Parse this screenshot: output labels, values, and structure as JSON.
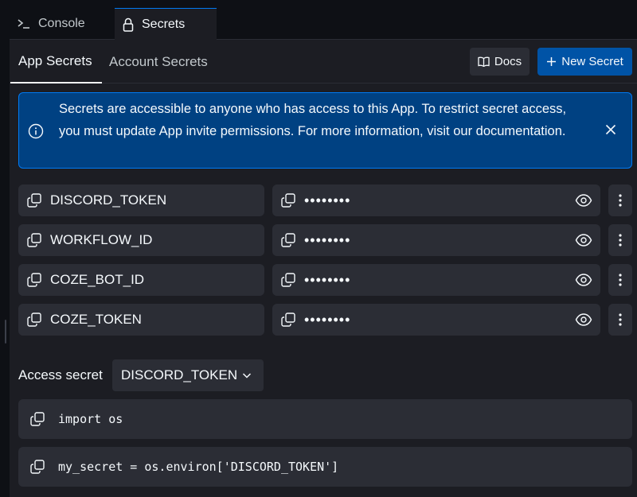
{
  "tabs": {
    "console_label": "Console",
    "secrets_label": "Secrets"
  },
  "subnav": {
    "app_secrets": "App Secrets",
    "account_secrets": "Account Secrets"
  },
  "actions": {
    "docs_label": "Docs",
    "new_secret_label": "New Secret"
  },
  "banner": {
    "message": "Secrets are accessible to anyone who has access to this App. To restrict secret access, you must update App invite permissions. For more information, visit our documentation."
  },
  "secrets": [
    {
      "key": "DISCORD_TOKEN",
      "masked_value": "••••••••"
    },
    {
      "key": "WORKFLOW_ID",
      "masked_value": "••••••••"
    },
    {
      "key": "COZE_BOT_ID",
      "masked_value": "••••••••"
    },
    {
      "key": "COZE_TOKEN",
      "masked_value": "••••••••"
    }
  ],
  "access": {
    "label": "Access secret",
    "selected": "DISCORD_TOKEN"
  },
  "code": {
    "line1": "import os",
    "line2": "my_secret = os.environ['DISCORD_TOKEN']"
  },
  "colors": {
    "background": "#1c1d23",
    "surface": "#2b2d35",
    "accent": "#0053a6",
    "banner_bg": "#004182",
    "banner_border": "#0079f2"
  },
  "icons": {
    "console": "terminal-prompt-icon",
    "secrets": "lock-icon",
    "docs": "book-icon",
    "new_secret": "plus-icon",
    "info": "info-icon",
    "close": "close-icon",
    "copy": "copy-icon",
    "reveal": "eye-icon",
    "more": "kebab-menu-icon",
    "dropdown": "chevron-down-icon"
  }
}
